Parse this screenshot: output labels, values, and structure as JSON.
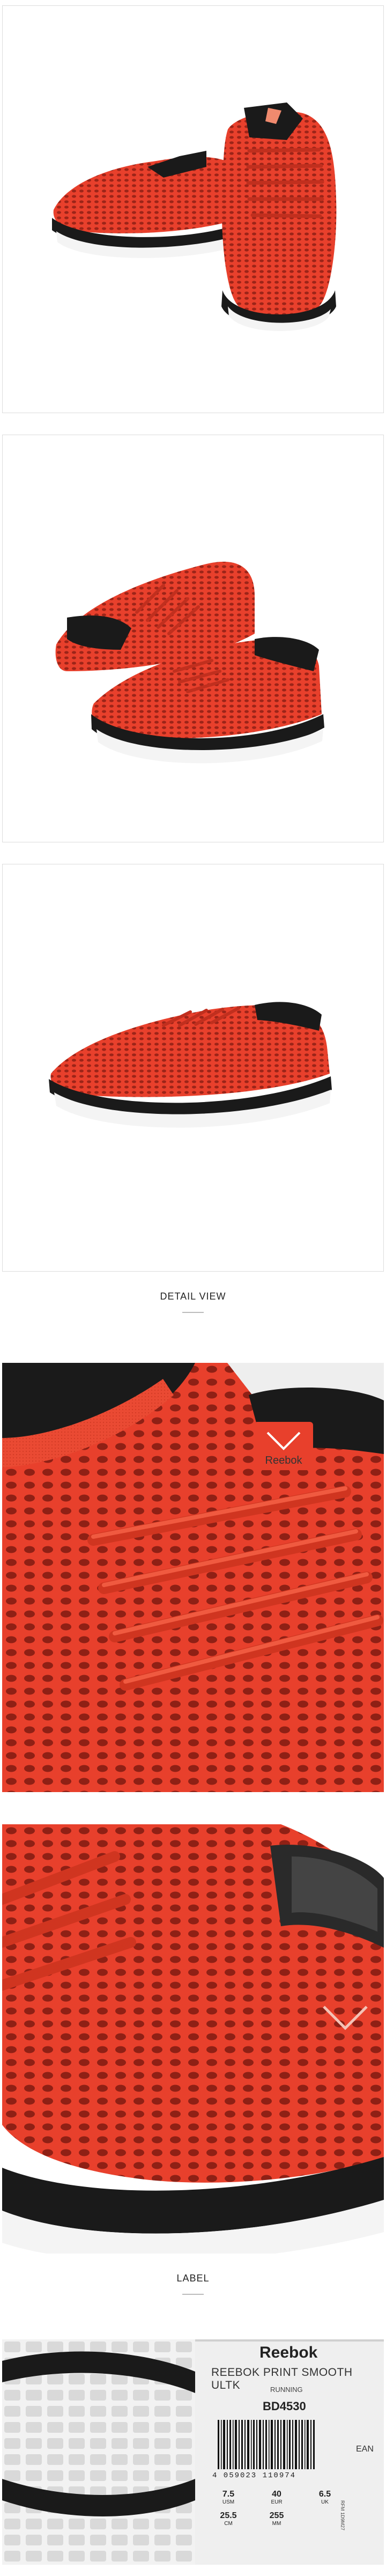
{
  "sections": {
    "detail_title": "DETAIL VIEW",
    "label_title": "LABEL"
  },
  "product_label": {
    "brand": "Reebok",
    "model": "REEBOK PRINT SMOOTH ULTK",
    "category": "RUNNING",
    "article": "BD4530",
    "ean_label": "EAN",
    "barcode_digits": "4 059023 110974",
    "sizes": {
      "us": {
        "value": "7.5",
        "unit": "USM"
      },
      "eur": {
        "value": "40",
        "unit": "EUR"
      },
      "uk": {
        "value": "6.5",
        "unit": "UK"
      },
      "cm": {
        "value": "25.5",
        "unit": "CM"
      },
      "mm": {
        "value": "255",
        "unit": "MM"
      }
    },
    "side_code": "RFM 1D9M27"
  },
  "colors": {
    "shoe_red": "#e8402c",
    "shoe_red_dark": "#c12f1e",
    "sole_black": "#1a1a1a",
    "sole_white": "#f4f4f4",
    "panel_border": "#dcdcdc"
  }
}
